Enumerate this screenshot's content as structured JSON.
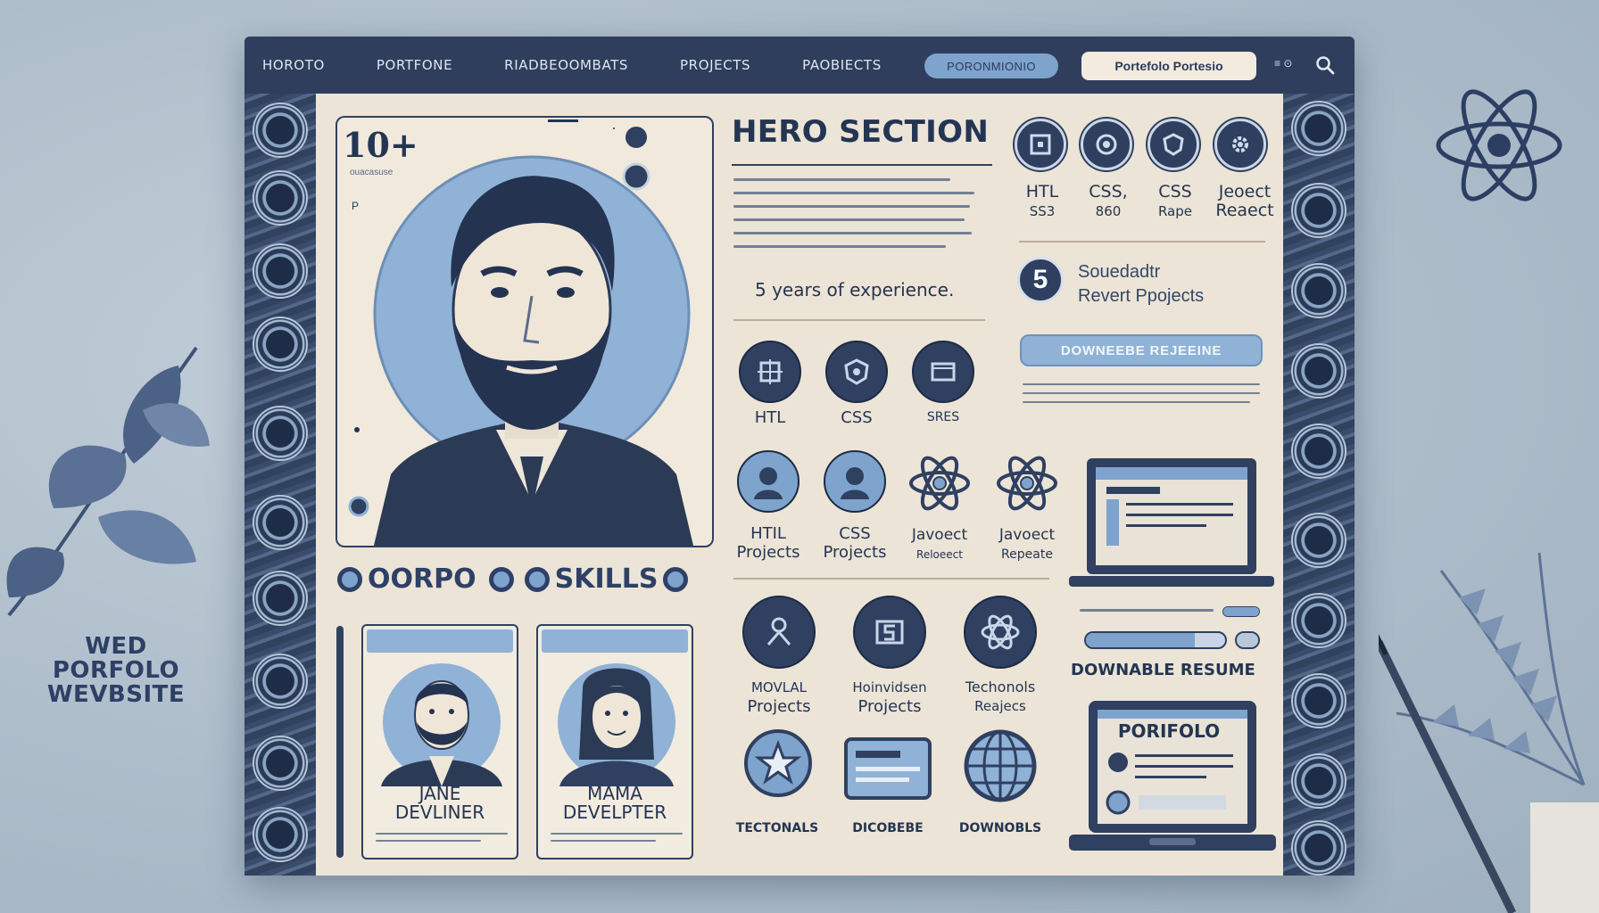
{
  "brand": {
    "side_title_lines": [
      "WED",
      "PORFOLO",
      "WEVBSITE"
    ]
  },
  "nav": {
    "items": [
      "HOROTO",
      "PORTFONE",
      "RIADBEOOMBATS",
      "PROJECTS",
      "PAOBIECTS"
    ],
    "pill_label": "PORONMIONIO",
    "button_label": "Portefolo Portesio",
    "small_label": "≡ ⊙"
  },
  "hero": {
    "count": "10+",
    "count_sub": "ouacasuse",
    "side_glyph": "P",
    "title": "HERO SECTION",
    "experience": "5 years of experience.",
    "five_number": "5",
    "five_lines": [
      "Souedadtr",
      "Revert Ppojects"
    ],
    "download_button": "DOWNEEBE REJEEINE"
  },
  "tech_top": [
    {
      "icon": "html-icon",
      "label": "HTL",
      "sub": "SS3"
    },
    {
      "icon": "css-icon",
      "label": "CSS,",
      "sub": "860"
    },
    {
      "icon": "shield-icon",
      "label": "CSS",
      "sub": "Rape"
    },
    {
      "icon": "gear-icon",
      "label": "Jeoect",
      "sub": "Reaect"
    }
  ],
  "skills_row1": [
    {
      "icon": "html-box-icon",
      "label": "HTL"
    },
    {
      "icon": "css-shield-icon",
      "label": "CSS"
    },
    {
      "icon": "window-icon",
      "label": "SRES"
    }
  ],
  "skills_row2": [
    {
      "icon": "person-icon",
      "label": "HTIL",
      "sub": "Projects"
    },
    {
      "icon": "person-icon",
      "label": "CSS",
      "sub": "Projects"
    },
    {
      "icon": "atom-icon",
      "label": "Javoect",
      "sub": "Reloeect"
    },
    {
      "icon": "atom-icon",
      "label": "Javoect",
      "sub": "Repeate"
    }
  ],
  "skills_row3": [
    {
      "icon": "person-outline-icon",
      "label": "MOVLAL",
      "sub": "Projects"
    },
    {
      "icon": "five-box-icon",
      "label": "Hoinvidsen",
      "sub": "Projects"
    },
    {
      "icon": "atom-icon",
      "label": "Techonols",
      "sub": "Reajecs"
    }
  ],
  "skills_row4": [
    {
      "icon": "star-icon",
      "label": "TECTONALS"
    },
    {
      "icon": "card-icon",
      "label": "DICOBEBE"
    },
    {
      "icon": "globe-icon",
      "label": "DOWNOBLS"
    }
  ],
  "skills_header": {
    "left": "OORPO",
    "right": "SKILLS"
  },
  "team": [
    {
      "name_lines": [
        "JANE",
        "DEVLINER"
      ]
    },
    {
      "name_lines": [
        "MAMA",
        "DEVELPTER"
      ]
    }
  ],
  "resume": {
    "label": "DOWNABLE RESUME",
    "progress": [
      0.52,
      0.78
    ],
    "portfolio_screen_title": "PORIFOLO"
  },
  "colors": {
    "navy": "#2e3f60",
    "accent_blue": "#7ea3cc",
    "paper": "#ece4d6"
  }
}
